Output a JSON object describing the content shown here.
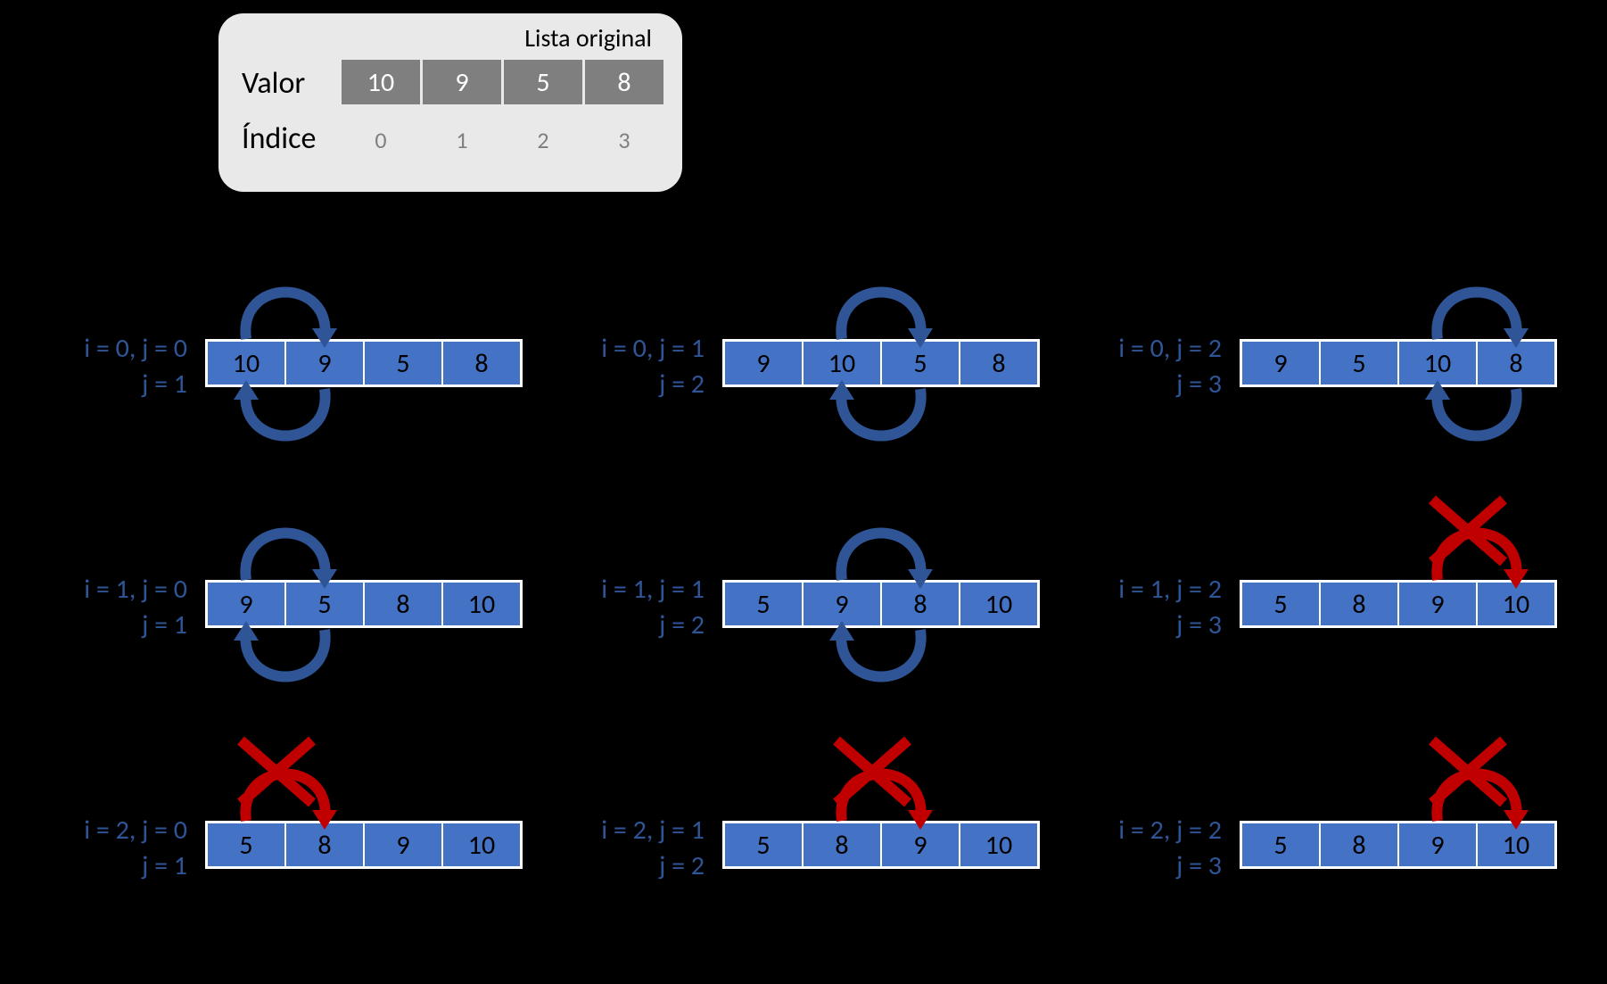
{
  "header": {
    "title": "Lista original",
    "valor_label": "Valor",
    "indice_label": "Índice",
    "values": [
      "10",
      "9",
      "5",
      "8"
    ],
    "indices": [
      "0",
      "1",
      "2",
      "3"
    ]
  },
  "steps": [
    {
      "id": "s00",
      "line1": "i = 0, j = 0",
      "line2": "j = 1",
      "values": [
        "10",
        "9",
        "5",
        "8"
      ],
      "swapCol": 0,
      "swap": true,
      "bottomArrow": true
    },
    {
      "id": "s01",
      "line1": "i = 0, j = 1",
      "line2": "j = 2",
      "values": [
        "9",
        "10",
        "5",
        "8"
      ],
      "swapCol": 1,
      "swap": true,
      "bottomArrow": true
    },
    {
      "id": "s02",
      "line1": "i = 0, j = 2",
      "line2": "j = 3",
      "values": [
        "9",
        "5",
        "10",
        "8"
      ],
      "swapCol": 2,
      "swap": true,
      "bottomArrow": true
    },
    {
      "id": "s10",
      "line1": "i = 1, j = 0",
      "line2": "j = 1",
      "values": [
        "9",
        "5",
        "8",
        "10"
      ],
      "swapCol": 0,
      "swap": true,
      "bottomArrow": true
    },
    {
      "id": "s11",
      "line1": "i = 1, j = 1",
      "line2": "j = 2",
      "values": [
        "5",
        "9",
        "8",
        "10"
      ],
      "swapCol": 1,
      "swap": true,
      "bottomArrow": true
    },
    {
      "id": "s12",
      "line1": "i = 1, j = 2",
      "line2": "j = 3",
      "values": [
        "5",
        "8",
        "9",
        "10"
      ],
      "swapCol": 2,
      "swap": false,
      "bottomArrow": false
    },
    {
      "id": "s20",
      "line1": "i = 2, j = 0",
      "line2": "j = 1",
      "values": [
        "5",
        "8",
        "9",
        "10"
      ],
      "swapCol": 0,
      "swap": false,
      "bottomArrow": false
    },
    {
      "id": "s21",
      "line1": "i = 2, j = 1",
      "line2": "j = 2",
      "values": [
        "5",
        "8",
        "9",
        "10"
      ],
      "swapCol": 1,
      "swap": false,
      "bottomArrow": false
    },
    {
      "id": "s22",
      "line1": "i = 2, j = 2",
      "line2": "j = 3",
      "values": [
        "5",
        "8",
        "9",
        "10"
      ],
      "swapCol": 2,
      "swap": false,
      "bottomArrow": false
    }
  ]
}
